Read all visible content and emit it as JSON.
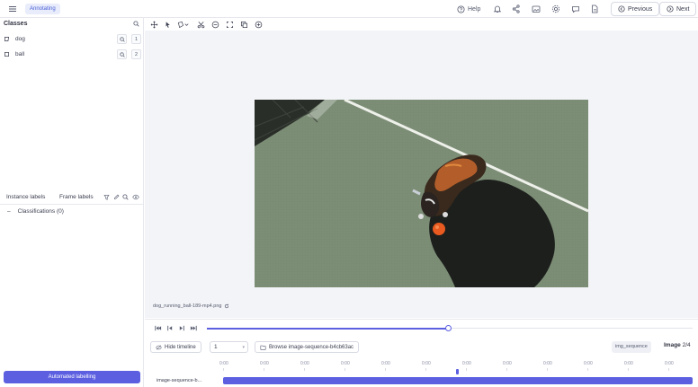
{
  "header": {
    "mode": "Annotating",
    "help_label": "Help",
    "previous_label": "Previous",
    "next_label": "Next",
    "icons": [
      "hamburger-icon",
      "help-icon",
      "bell-icon",
      "share-icon",
      "image-icon",
      "settings-icon",
      "chat-icon",
      "document-icon"
    ]
  },
  "sidebar": {
    "classes_title": "Classes",
    "classes": [
      {
        "label": "dog",
        "hotkey": "1"
      },
      {
        "label": "ball",
        "hotkey": "2"
      }
    ],
    "tabs": {
      "instance": "Instance labels",
      "frame": "Frame labels"
    },
    "classifications": {
      "toggle": "–",
      "label": "Classifications (0)"
    },
    "auto_button": "Automated labelling"
  },
  "canvas": {
    "filename": "dog_running_ball-189-mp4.png"
  },
  "playback": {
    "hide_button": "Hide timeline",
    "frame_value": "1",
    "browse_button": "Browse image-sequence-b4cb63ac",
    "sequence_tag": "img_sequence",
    "image_label": "Image",
    "image_counter": "2/4",
    "ticks": [
      "0:00",
      "0:00",
      "0:00",
      "0:00",
      "0:00",
      "0:00",
      "0:00",
      "0:00",
      "0:00",
      "0:00",
      "0:00",
      "0:00"
    ],
    "track_label": "image-sequence-b...",
    "progress": 0.5
  },
  "colors": {
    "accent": "#5b5fe0",
    "court": "#7b8c75",
    "shadow": "#1d1f1c",
    "ball": "#e85a1f"
  }
}
